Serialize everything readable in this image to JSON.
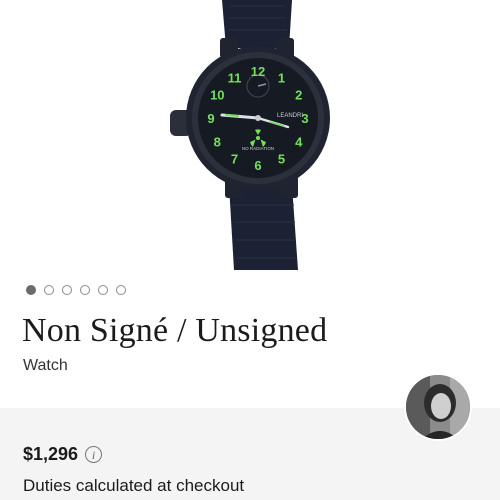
{
  "product": {
    "image": {
      "brand_text": "LEANDRI",
      "dial_caption": "NO RADIATION",
      "dial_numerals": [
        "12",
        "1",
        "2",
        "3",
        "4",
        "5",
        "6",
        "7",
        "8",
        "9",
        "10",
        "11"
      ]
    },
    "carousel": {
      "count": 6,
      "active_index": 0
    },
    "title": "Non Signé / Unsigned",
    "subtitle": "Watch"
  },
  "pricing": {
    "price": "$1,296",
    "info_glyph": "i",
    "duties_note": "Duties calculated at checkout"
  },
  "seller": {
    "avatar_icon": "seller-avatar"
  },
  "colors": {
    "lume_green": "#74e05a",
    "watch_case": "#1f2430",
    "strap": "#1c2233",
    "price_panel_bg": "#f4f4f4"
  }
}
